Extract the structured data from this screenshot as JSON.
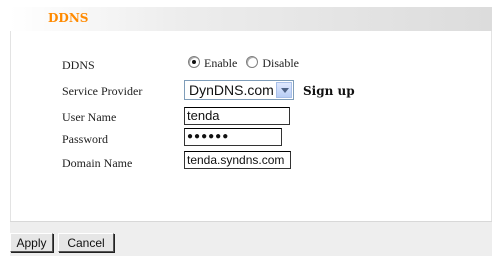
{
  "header": {
    "title": "DDNS"
  },
  "form": {
    "ddns": {
      "label": "DDNS",
      "options": [
        {
          "label": "Enable",
          "checked": true
        },
        {
          "label": "Disable",
          "checked": false
        }
      ]
    },
    "service_provider": {
      "label": "Service Provider",
      "value": "DynDNS.com",
      "signup_label": "Sign up"
    },
    "user_name": {
      "label": "User Name",
      "value": "tenda"
    },
    "password": {
      "label": "Password",
      "value": "●●●●●●"
    },
    "domain_name": {
      "label": "Domain Name",
      "value": "tenda.syndns.com"
    }
  },
  "buttons": {
    "apply": "Apply",
    "cancel": "Cancel"
  },
  "colors": {
    "title": "#ff8a00",
    "panel_bg": "#eeeeee",
    "select_border": "#7f9db9"
  }
}
